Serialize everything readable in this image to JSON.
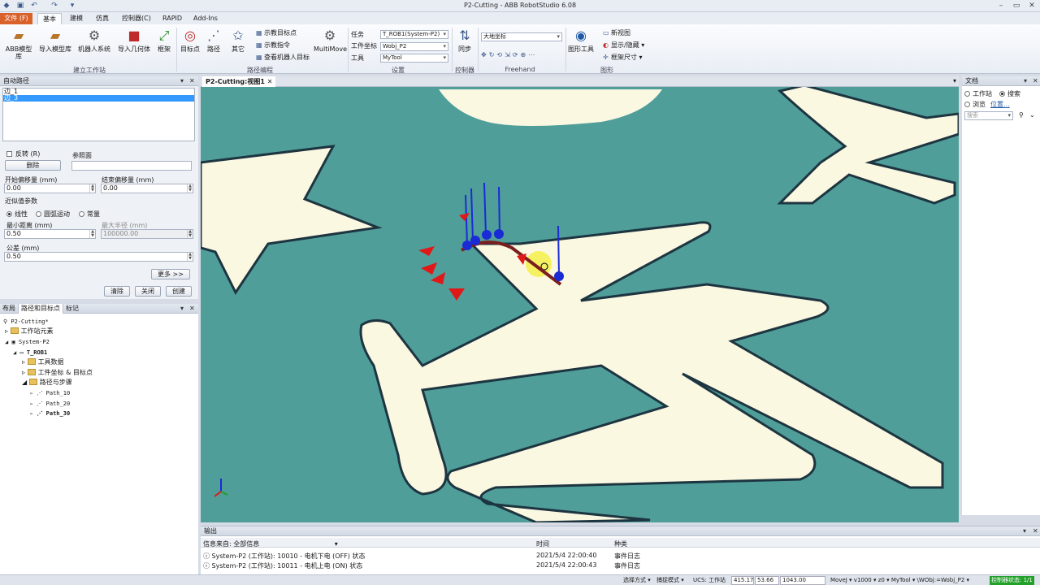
{
  "title": "P2-Cutting - ABB RobotStudio 6.08",
  "menu_tabs": [
    "文件 (F)",
    "基本",
    "建模",
    "仿真",
    "控制器(C)",
    "RAPID",
    "Add-Ins"
  ],
  "ribbon": {
    "abb_library": "ABB模型库",
    "import_library": "导入模型库",
    "robot_system": "机器人系统",
    "import_geometry": "导入几何体",
    "frame": "框架",
    "group_build": "建立工作站",
    "target": "目标点",
    "path": "路径",
    "other": "其它",
    "teach_target": "示教目标点",
    "teach_instruction": "示教指令",
    "view_robot_target": "查看机器人目标",
    "multimove": "MultiMove",
    "group_path": "路径编程",
    "task_label": "任务",
    "task_value": "T_ROB1(System-P2)",
    "wobj_label": "工件坐标",
    "wobj_value": "Wobj_P2",
    "tool_label": "工具",
    "tool_value": "MyTool",
    "group_settings": "设置",
    "sync": "同步",
    "group_controller": "控制器",
    "ref_frame": "大地坐标",
    "group_freehand": "Freehand",
    "graphics_tools": "图形工具",
    "new_view": "新视图",
    "show_hide": "显示/隐藏",
    "frame_size": "框架尺寸",
    "group_graphics": "图形"
  },
  "auto_path": {
    "header": "自动路径",
    "edges": [
      "边_1",
      "边_3"
    ],
    "reverse": "反转 (R)",
    "ref_surface": "参照面",
    "delete": "删除",
    "start_offset_label": "开始偏移量 (mm)",
    "start_offset": "0.00",
    "end_offset_label": "结束偏移量 (mm)",
    "end_offset": "0.00",
    "approx_label": "近似值参数",
    "linear": "线性",
    "circular": "圆弧运动",
    "constant": "常量",
    "min_dist_label": "最小距离 (mm)",
    "min_dist": "0.50",
    "max_radius_label": "最大半径 (mm)",
    "max_radius": "100000.00",
    "tolerance_label": "公差 (mm)",
    "tolerance": "0.50",
    "more": "更多 >>",
    "clear": "清除",
    "close": "关闭",
    "create": "创建"
  },
  "layout_panel": {
    "tabs": [
      "布局",
      "路径和目标点",
      "标记"
    ],
    "tree": [
      {
        "label": "P2-Cutting*",
        "level": 0
      },
      {
        "label": "工作站元素",
        "level": 1
      },
      {
        "label": "System-P2",
        "level": 1
      },
      {
        "label": "T_ROB1",
        "level": 2
      },
      {
        "label": "工具数据",
        "level": 3
      },
      {
        "label": "工件坐标 & 目标点",
        "level": 3
      },
      {
        "label": "路径与步骤",
        "level": 3
      },
      {
        "label": "Path_10",
        "level": 4
      },
      {
        "label": "Path_20",
        "level": 4
      },
      {
        "label": "Path_30",
        "level": 4
      }
    ]
  },
  "viewport_tab": "P2-Cutting:视图1",
  "docs": {
    "header": "文档",
    "station": "工作站",
    "search": "搜索",
    "browse": "浏览",
    "location": "位置...",
    "search_placeholder": "搜索"
  },
  "output": {
    "header": "输出",
    "filter_label": "信息来自: 全部信息",
    "col_time": "时间",
    "col_type": "种类",
    "rows": [
      {
        "msg": "System-P2 (工作站): 10010 - 电机下电 (OFF) 状态",
        "time": "2021/5/4 22:00:40",
        "type": "事件日志"
      },
      {
        "msg": "System-P2 (工作站): 10011 - 电机上电 (ON) 状态",
        "time": "2021/5/4 22:00:43",
        "type": "事件日志"
      }
    ]
  },
  "status": {
    "select_mode": "选择方式 ▾",
    "snap_mode": "捕捉模式 ▾",
    "ucs": "UCS: 工作站",
    "x": "415.17",
    "y": "53.66",
    "z": "1043.00",
    "motion": "MoveJ ▾ v1000 ▾ z0 ▾ MyTool ▾ \\WObj:=Wobj_P2 ▾",
    "controller_state": "控制器状态: 1/1"
  }
}
